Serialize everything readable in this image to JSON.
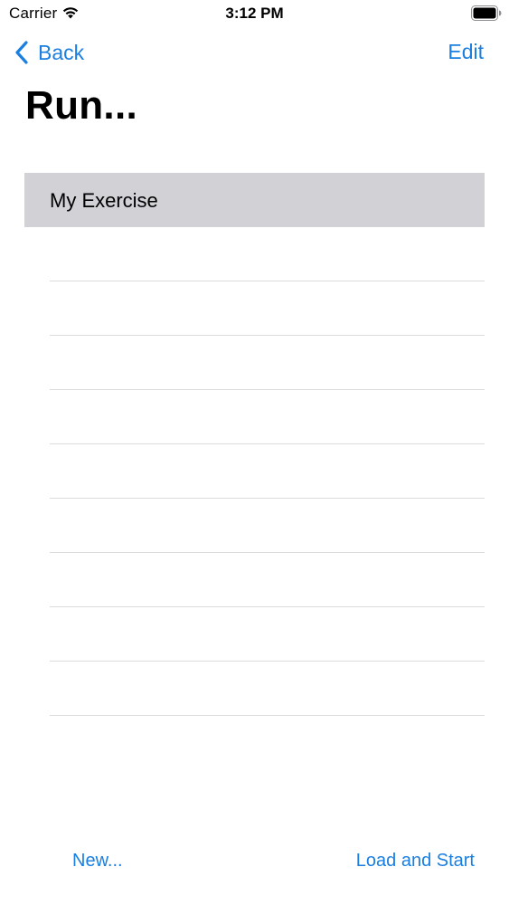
{
  "status_bar": {
    "carrier": "Carrier",
    "time": "3:12 PM",
    "wifi_icon": "wifi-icon",
    "battery_icon": "battery-icon"
  },
  "nav": {
    "back_label": "Back",
    "edit_label": "Edit",
    "back_icon": "chevron-left-icon"
  },
  "page": {
    "title": "Run..."
  },
  "list": {
    "items": [
      {
        "label": "My Exercise",
        "selected": true
      },
      {
        "label": ""
      },
      {
        "label": ""
      },
      {
        "label": ""
      },
      {
        "label": ""
      },
      {
        "label": ""
      },
      {
        "label": ""
      },
      {
        "label": ""
      },
      {
        "label": ""
      },
      {
        "label": ""
      }
    ]
  },
  "toolbar": {
    "new_label": "New...",
    "load_label": "Load and Start"
  },
  "colors": {
    "accent": "#1a7fe0",
    "selected_row": "#d2d1d6",
    "separator": "#dcdcde"
  }
}
